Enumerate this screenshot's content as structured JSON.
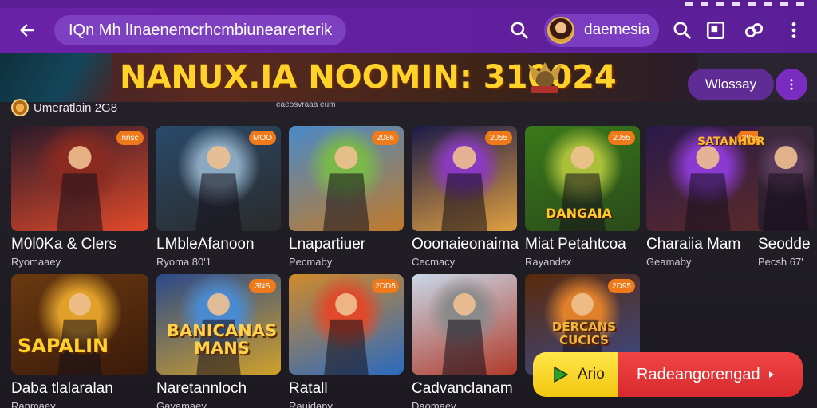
{
  "app": {
    "search_text": "IQn Mh lInaenemcrhcmbiunearerterik",
    "user_name": "daemesia"
  },
  "banner": {
    "title": "NANUX.IA NOOMIN: 310024",
    "button_label": "Wlossay"
  },
  "section": {
    "title": "Umeratlain 2G8",
    "meta": "eaeosvraaa eum"
  },
  "rows": [
    [
      {
        "title": "M0l0Ka & Clers",
        "sub": "Ryomaaey",
        "badge": "nnsc",
        "colors": [
          "#2a1a2a",
          "#8a2a20",
          "#e24a2a"
        ]
      },
      {
        "title": "LMbleAfanoon",
        "sub": "Ryoma 80'1",
        "badge": "MOO",
        "colors": [
          "#2a4a6a",
          "#8aa8c0",
          "#2a2a2a"
        ]
      },
      {
        "title": "Lnapartiuer",
        "sub": "Pecmaby",
        "badge": "2086",
        "colors": [
          "#4a8ac8",
          "#7ab84a",
          "#c07a2a"
        ]
      },
      {
        "title": "Ooonaieonaima",
        "sub": "Cecmacy",
        "badge": "2055",
        "colors": [
          "#1a1a4a",
          "#8a3ac0",
          "#e0a040"
        ]
      },
      {
        "title": "Miat Petahtcoa",
        "sub": "Rayandex",
        "badge": "2055",
        "colors": [
          "#3a7a1a",
          "#aac03a",
          "#2a4a1a"
        ]
      },
      {
        "title": "Charaiia Mam",
        "sub": "Geamaby",
        "badge": "2055",
        "colors": [
          "#2a1a4a",
          "#8a3ad0",
          "#5a2a2a"
        ]
      },
      {
        "title": "Seodde",
        "sub": "Pecsh 67'",
        "badge": "",
        "colors": [
          "#3a2a3a",
          "#5a3a5a",
          "#2a1a2a"
        ]
      }
    ],
    [
      {
        "title": "Daba tlalaralan",
        "sub": "Ranmaey",
        "badge": "",
        "colors": [
          "#6a3a10",
          "#e0a02a",
          "#3a1a0a"
        ]
      },
      {
        "title": "Naretannloch",
        "sub": "Gayamaey",
        "badge": "3NS",
        "colors": [
          "#2a4a8a",
          "#4a8ad0",
          "#d0a02a"
        ]
      },
      {
        "title": "Ratall",
        "sub": "Rauidany",
        "badge": "2DD5",
        "colors": [
          "#d08a2a",
          "#e04a2a",
          "#2a6ac0"
        ]
      },
      {
        "title": "Cadvanclanam",
        "sub": "Daomaey",
        "badge": "",
        "colors": [
          "#c8d8e8",
          "#8a8a8a",
          "#b03a2a"
        ]
      },
      {
        "title": "",
        "sub": "",
        "badge": "2D95",
        "colors": [
          "#5a2a0a",
          "#e0802a",
          "#3a4a8a"
        ]
      }
    ]
  ],
  "inner_text": {
    "r2c1": "SAPALIN",
    "r2c2": "BANICANAS MANS",
    "r2c5": "DERCANS CUCICS",
    "r1c5": "DANGAIA",
    "r1c6": "SATANHUR"
  },
  "cta": {
    "yellow_label": "Ario",
    "red_label": "Radeangorengad"
  },
  "colors": {
    "header": "#6a22a8",
    "accent": "#7a2cc0",
    "banner_text": "#ffd22a",
    "cta_yellow": "#f3c70f",
    "cta_red": "#e23636"
  }
}
